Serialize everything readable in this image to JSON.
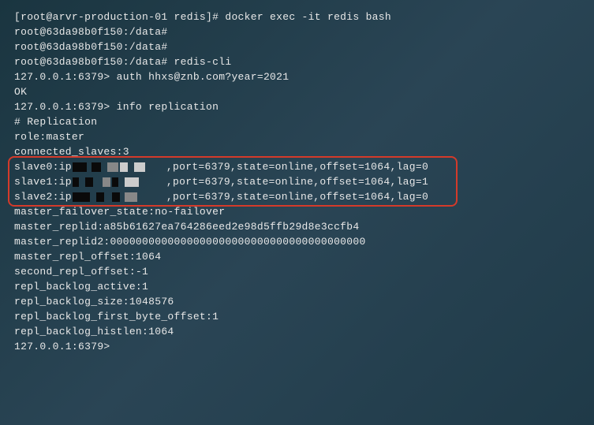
{
  "lines": {
    "l0": "[root@arvr-production-01 redis]# docker exec -it redis bash",
    "l1": "root@63da98b0f150:/data#",
    "l2": "root@63da98b0f150:/data#",
    "l3": "root@63da98b0f150:/data# redis-cli",
    "l4": "127.0.0.1:6379> auth hhxs@znb.com?year=2021",
    "l5": "OK",
    "l6": "127.0.0.1:6379> info replication",
    "l7": "# Replication",
    "l8": "role:master",
    "l9": "connected_slaves:3"
  },
  "slaves": [
    {
      "prefix": "slave0:ip",
      "suffix": ",port=6379,state=online,offset=1064,lag=0"
    },
    {
      "prefix": "slave1:ip",
      "suffix": ",port=6379,state=online,offset=1064,lag=1"
    },
    {
      "prefix": "slave2:ip",
      "suffix": ",port=6379,state=online,offset=1064,lag=0"
    }
  ],
  "lines2": {
    "l10": "master_failover_state:no-failover",
    "l11": "master_replid:a85b61627ea764286eed2e98d5ffb29d8e3ccfb4",
    "l12": "master_replid2:0000000000000000000000000000000000000000",
    "l13": "master_repl_offset:1064",
    "l14": "second_repl_offset:-1",
    "l15": "repl_backlog_active:1",
    "l16": "repl_backlog_size:1048576",
    "l17": "repl_backlog_first_byte_offset:1",
    "l18": "repl_backlog_histlen:1064",
    "l19": "127.0.0.1:6379>"
  }
}
